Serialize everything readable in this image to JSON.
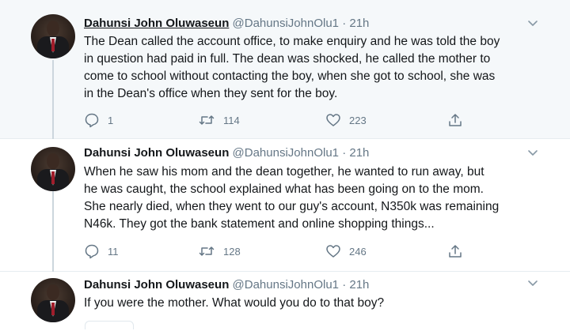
{
  "tweets": [
    {
      "name": "Dahunsi John Oluwaseun",
      "handle": "@DahunsiJohnOlu1",
      "separator": "·",
      "time": "21h",
      "lines": [
        "The Dean called the account office, to make enquiry and he was told the boy",
        "in question had paid in full. The dean was shocked, he called the mother to",
        "come to school without contacting the boy, when she got to school, she was",
        "in the Dean's office when they sent for the boy."
      ],
      "replies": "1",
      "retweets": "114",
      "likes": "223"
    },
    {
      "name": "Dahunsi John Oluwaseun",
      "handle": "@DahunsiJohnOlu1",
      "separator": "·",
      "time": "21h",
      "lines": [
        "When he saw his mom and the dean together, he wanted to run away, but",
        "he was caught, the school explained what has been going on to the mom.",
        "She nearly died, when they went to our guy's account, N350k was remaining",
        "N46k. They got the bank statement and online shopping things..."
      ],
      "replies": "11",
      "retweets": "128",
      "likes": "246"
    },
    {
      "name": "Dahunsi John Oluwaseun",
      "handle": "@DahunsiJohnOlu1",
      "separator": "·",
      "time": "21h",
      "lines": [
        "If you were the mother. What would you do to that boy?"
      ]
    }
  ],
  "icons": {
    "reply": "reply-icon",
    "retweet": "retweet-icon",
    "like": "heart-icon",
    "share": "share-icon",
    "caret": "chevron-down-icon"
  },
  "colors": {
    "text": "#14171a",
    "muted": "#657786",
    "highlight_bg": "#f5f8fa",
    "border": "#e6ecf0"
  }
}
